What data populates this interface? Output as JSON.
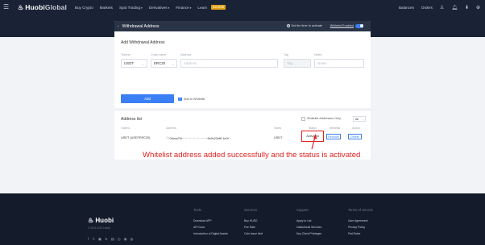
{
  "nav": {
    "logo_main": "Huobi",
    "logo_sub": "Global",
    "links": [
      "Buy Crypto",
      "Markets",
      "Spot Trading",
      "Derivatives",
      "Finance",
      "Learn"
    ],
    "badge": "Get BTB",
    "right_links": [
      "Balances",
      "Orders"
    ]
  },
  "page": {
    "title": "Withdrawal Address",
    "tip": "Set the time to activate",
    "whitelist_label": "Whitelist Enabled"
  },
  "form": {
    "section_title": "Add Withdrawal Address",
    "token_label": "Tokens",
    "token_value": "USDT",
    "chain_label": "Chain name",
    "chain_value": "ERC20",
    "address_label": "Address",
    "address_placeholder": "Address",
    "tag_label": "Tag",
    "tag_placeholder": "Tag",
    "notes_label": "Notes",
    "notes_placeholder": "Notes",
    "add_button": "Add",
    "add_to_whitelist": "Add to Whitelist"
  },
  "list": {
    "section_title": "Address list",
    "whitelist_only": "Whitelist Addresses Only",
    "filter_value": "All",
    "headers": [
      "Tokens",
      "Address",
      "Notes",
      "Status",
      "Whitelist",
      "Action"
    ],
    "row": {
      "token": "USDT (USDTERC20)",
      "address": "0xbca7f4·························6e9c22ef8 1e0f",
      "notes": "USDT",
      "status": "Activated",
      "remove": "Remove",
      "delete": "Delete"
    }
  },
  "annotation": "Whitelist address added successfully and the status is activated",
  "footer": {
    "logo": "Huobi",
    "copyright": "© 2013-2021 Huobi",
    "columns": [
      {
        "title": "Tools",
        "items": [
          "Download APP",
          "API Docs",
          "Introduction of Digital Assets"
        ]
      },
      {
        "title": "Services",
        "items": [
          "Buy HUSD",
          "Fee Rate",
          "Coin Issue limit"
        ]
      },
      {
        "title": "Support",
        "items": [
          "Apply to List",
          "Institutional Services",
          "Key Client Privileges"
        ]
      },
      {
        "title": "Terms of Service",
        "items": [
          "User Agreement",
          "Privacy Policy",
          "Fiat Rules"
        ]
      }
    ]
  }
}
